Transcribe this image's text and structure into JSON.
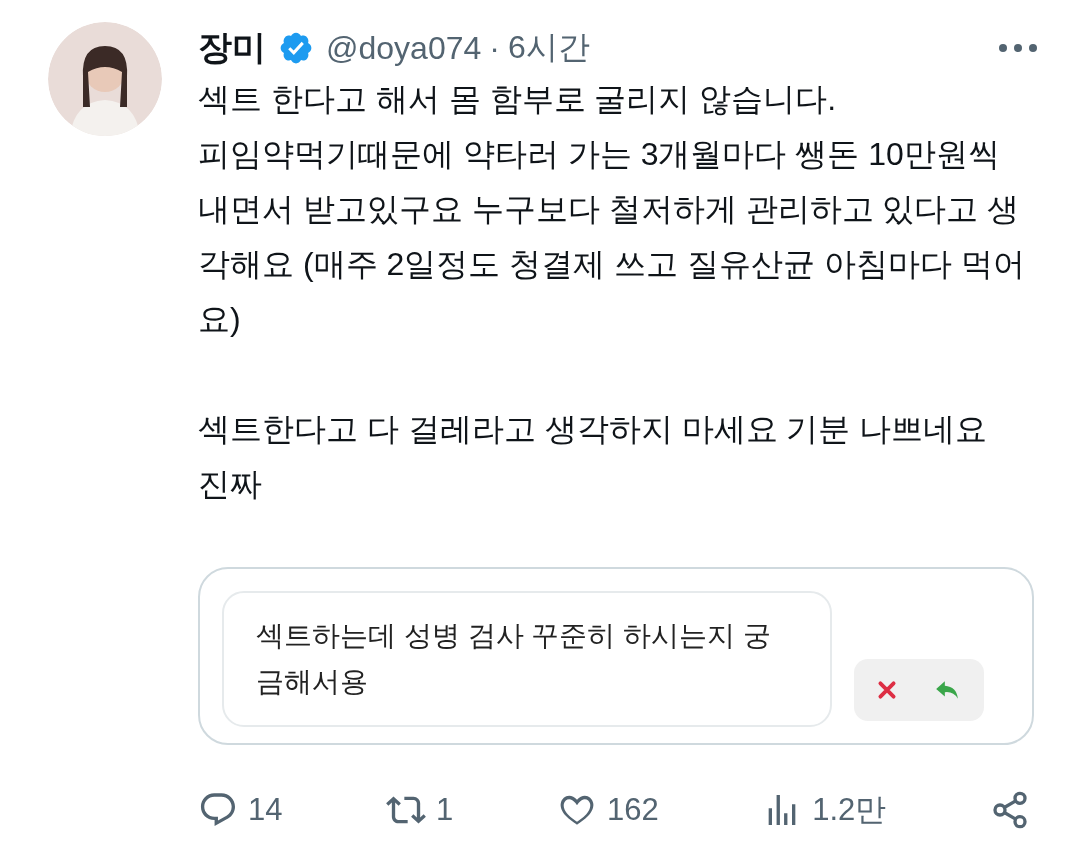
{
  "author": {
    "name": "장미",
    "verified": true,
    "handle": "@doya074",
    "separator": "·",
    "time": "6시간"
  },
  "body": [
    "섹트 한다고 해서 몸 함부로 굴리지 않습니다.\n피임약먹기때문에 약타러 가는 3개월마다 쌩돈 10만원씩 내면서 받고있구요 누구보다 철저하게 관리하고 있다고 생각해요 (매주 2일정도 청결제 쓰고 질유산균 아침마다 먹어요)",
    "섹트한다고 다 걸레라고 생각하지 마세요 기분 나쁘네요 진짜"
  ],
  "quote": {
    "text": "섹트하는데 성병 검사 꾸준히 하시는지 궁금해서용"
  },
  "actions": [
    {
      "kind": "reply",
      "count": "14"
    },
    {
      "kind": "retweet",
      "count": "1"
    },
    {
      "kind": "like",
      "count": "162"
    },
    {
      "kind": "views",
      "count": "1.2만"
    },
    {
      "kind": "share"
    }
  ]
}
